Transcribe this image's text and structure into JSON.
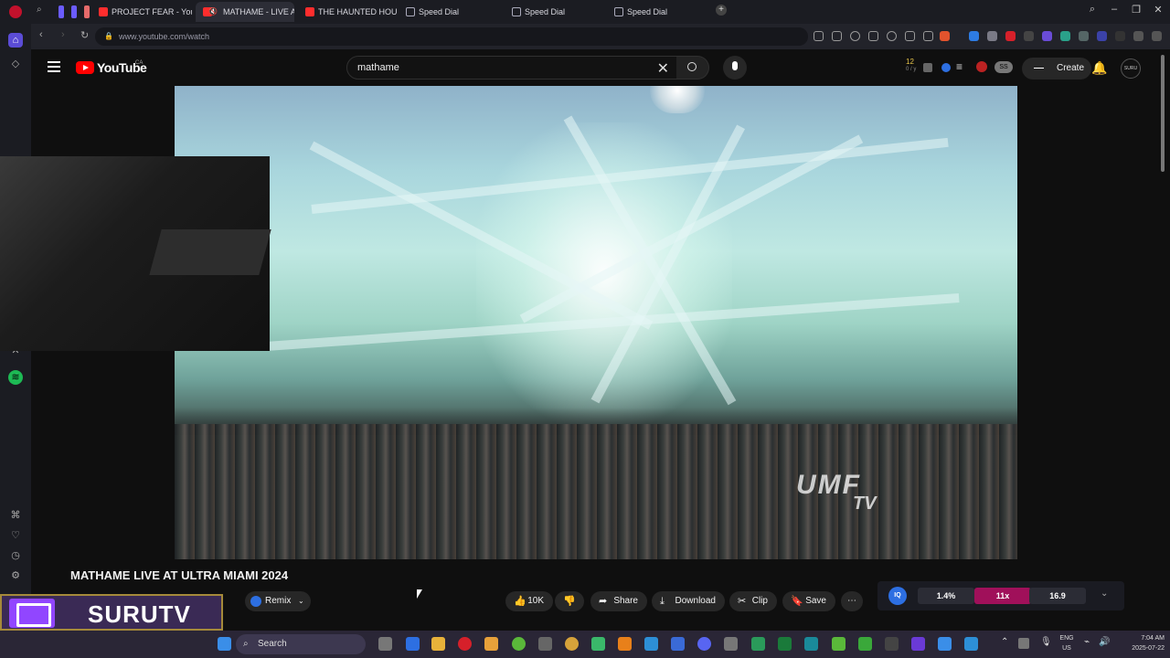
{
  "browser": {
    "tabs": [
      {
        "label": "PROJECT FEAR - YouTube",
        "icon": "youtube-icon"
      },
      {
        "label": "MATHAME - LIVE A... ",
        "icon": "youtube-icon",
        "muted": true
      },
      {
        "label": "THE HAUNTED HOUSE I...",
        "icon": "youtube-icon"
      },
      {
        "label": "Speed Dial",
        "icon": "speed-dial-icon"
      },
      {
        "label": "Speed Dial",
        "icon": "speed-dial-icon"
      },
      {
        "label": "Speed Dial",
        "icon": "speed-dial-icon"
      }
    ],
    "url": "www.youtube.com/watch"
  },
  "youtube": {
    "logo_text": "YouTube",
    "region": "CA",
    "search_value": "mathame",
    "create_label": "Create",
    "notif_count": "12",
    "notif_sub": "0 / y",
    "avatar_text": "SURU"
  },
  "video": {
    "watermark_main": "UMF",
    "watermark_sub": "TV",
    "title": "MATHAME LIVE AT ULTRA MIAMI 2024"
  },
  "actions": {
    "remix": "Remix",
    "likes": "10K",
    "share": "Share",
    "download": "Download",
    "clip": "Clip",
    "save": "Save"
  },
  "stats": {
    "badge": "IQ",
    "a": "1.4%",
    "b": "11x",
    "c": "16.9",
    "colors": {
      "b_bg": "#a0105a"
    }
  },
  "overlay": {
    "twitch_name": "SURUTV"
  },
  "taskbar": {
    "search_label": "Search",
    "lang_top": "ENG",
    "lang_bottom": "US",
    "time": "7:04 AM",
    "date": "2025-07-22"
  }
}
